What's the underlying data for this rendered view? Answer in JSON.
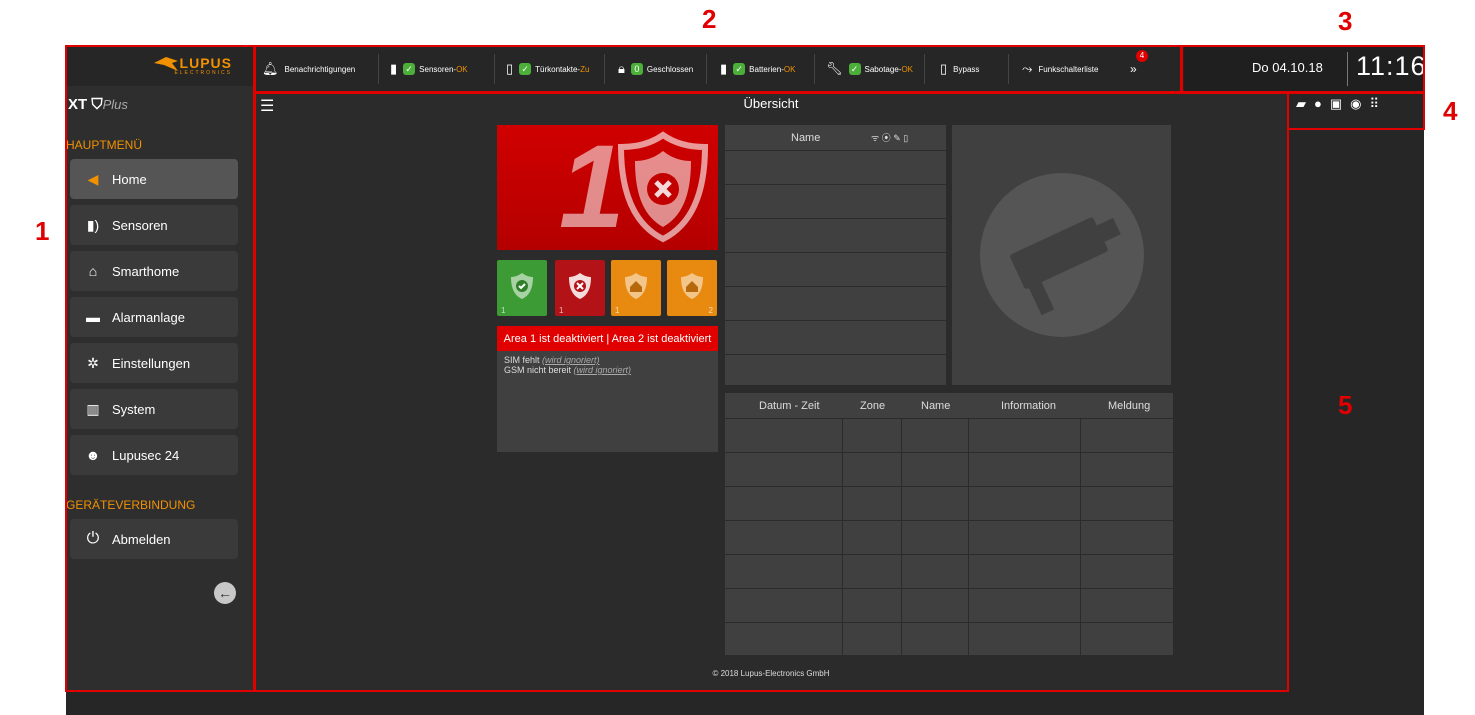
{
  "annotations": [
    "1",
    "2",
    "3",
    "4",
    "5"
  ],
  "brand": {
    "name": "LUPUS",
    "sub": "ELECTRONICS",
    "product": "XT",
    "product_suffix": "Plus",
    "accent": "#f29100"
  },
  "sidebar": {
    "section_main": "HAUPTMENÜ",
    "items": [
      {
        "label": "Home",
        "icon": "bird-icon"
      },
      {
        "label": "Sensoren",
        "icon": "sensor-icon"
      },
      {
        "label": "Smarthome",
        "icon": "house-icon"
      },
      {
        "label": "Alarmanlage",
        "icon": "alarm-panel-icon"
      },
      {
        "label": "Einstellungen",
        "icon": "gear-icon"
      },
      {
        "label": "System",
        "icon": "system-icon"
      },
      {
        "label": "Lupusec 24",
        "icon": "users-icon"
      }
    ],
    "section_device": "GERÄTEVERBINDUNG",
    "logout": "Abmelden"
  },
  "topbar": {
    "notifications": "Benachrichtigungen",
    "sensors": "Sensoren",
    "sensors_state": "OK",
    "doors": "Türkontakte",
    "doors_state": "Zu",
    "closed_count": "0",
    "closed": "Geschlossen",
    "batteries": "Batterien",
    "batteries_state": "OK",
    "tamper": "Sabotage",
    "tamper_state": "OK",
    "bypass": "Bypass",
    "switch_list": "Funkschalterliste",
    "more_count": "4",
    "sep": " - "
  },
  "clock": {
    "date": "Do 04.10.18",
    "time": "11:16"
  },
  "main": {
    "title": "Übersicht",
    "alarm_number": "1",
    "areas": [
      {
        "n": "1",
        "color": "#3d9b35",
        "state": "ok"
      },
      {
        "n": "1",
        "color": "#b31217",
        "state": "alarm"
      },
      {
        "n": "1",
        "color": "#e88a10",
        "state": "home"
      },
      {
        "n": "2",
        "color": "#e88a10",
        "state": "home"
      }
    ],
    "area_status": "Area 1 ist deaktiviert  |  Area 2 ist deaktiviert",
    "messages": [
      {
        "text": "SIM fehlt",
        "note": "(wird ignoriert)"
      },
      {
        "text": "GSM nicht bereit",
        "note": "(wird ignoriert)"
      }
    ],
    "sensor_table": {
      "name_col": "Name"
    },
    "log_table": {
      "cols": [
        "Datum - Zeit",
        "Zone",
        "Name",
        "Information",
        "Meldung"
      ]
    },
    "footer": "© 2018 Lupus-Electronics GmbH"
  }
}
